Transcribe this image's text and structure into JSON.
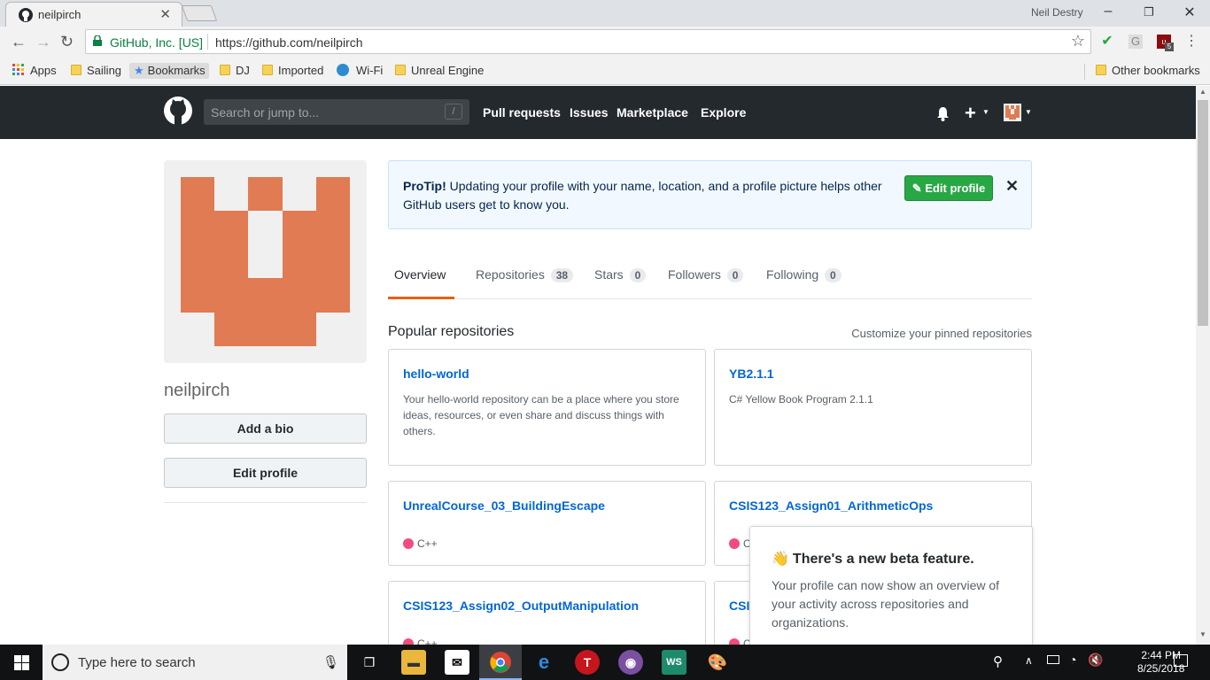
{
  "browser": {
    "tab_title": "neilpirch",
    "profile_name": "Neil Destry",
    "cert_label": "GitHub, Inc. [US]",
    "url": "https://github.com/neilpirch",
    "ext_badge": "5",
    "bookmarks": [
      "Apps",
      "Sailing",
      "Bookmarks",
      "DJ",
      "Imported",
      "Wi-Fi",
      "Unreal Engine"
    ],
    "other_bookmarks": "Other bookmarks"
  },
  "gh_header": {
    "search_placeholder": "Search or jump to...",
    "search_key": "/",
    "nav": [
      "Pull requests",
      "Issues",
      "Marketplace",
      "Explore"
    ]
  },
  "profile": {
    "username": "neilpirch",
    "add_bio": "Add a bio",
    "edit_profile": "Edit profile",
    "avatar_color": "#e07b53"
  },
  "protip": {
    "label": "ProTip!",
    "text": " Updating your profile with your name, location, and a profile picture helps other GitHub users get to know you.",
    "edit_button": "Edit profile"
  },
  "tabs": [
    {
      "label": "Overview",
      "count": null
    },
    {
      "label": "Repositories",
      "count": "38"
    },
    {
      "label": "Stars",
      "count": "0"
    },
    {
      "label": "Followers",
      "count": "0"
    },
    {
      "label": "Following",
      "count": "0"
    }
  ],
  "popular": {
    "title": "Popular repositories",
    "customize": "Customize your pinned repositories",
    "repos": [
      {
        "name": "hello-world",
        "desc": "Your hello-world repository can be a place where you store ideas, resources, or even share and discuss things with others."
      },
      {
        "name": "YB2.1.1",
        "desc": "C# Yellow Book Program 2.1.1"
      },
      {
        "name": "UnrealCourse_03_BuildingEscape",
        "lang": "C++"
      },
      {
        "name": "CSIS123_Assign01_ArithmeticOps",
        "lang": "C"
      },
      {
        "name": "CSIS123_Assign02_OutputManipulation",
        "lang": "C++"
      },
      {
        "name": "CSIS",
        "lang": "C"
      }
    ]
  },
  "beta_popover": {
    "title": "There's a new beta feature.",
    "body": "Your profile can now show an overview of your activity across repositories and organizations."
  },
  "taskbar": {
    "search_placeholder": "Type here to search",
    "time": "2:44 PM",
    "date": "8/25/2018"
  }
}
